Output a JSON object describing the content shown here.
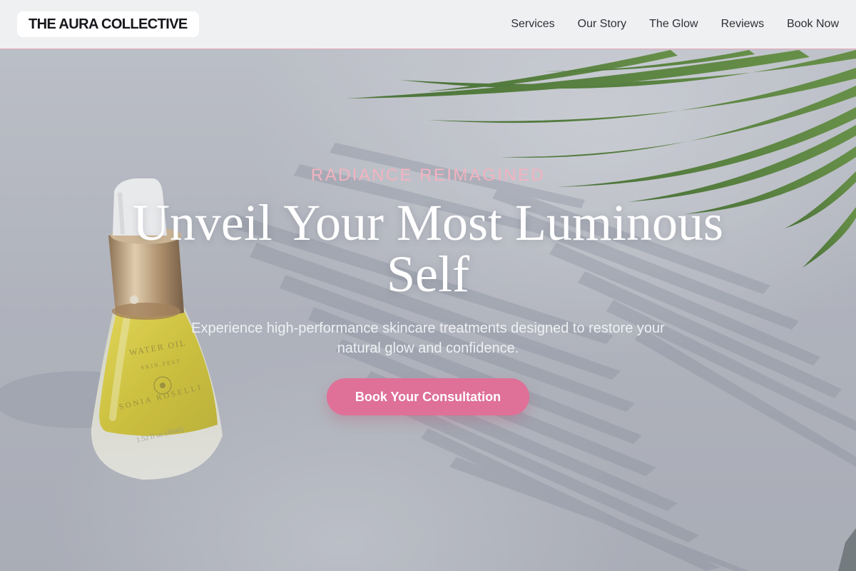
{
  "brand": {
    "name": "THE AURA COLLECTIVE"
  },
  "nav": {
    "items": [
      {
        "label": "Services"
      },
      {
        "label": "Our Story"
      },
      {
        "label": "The Glow"
      },
      {
        "label": "Reviews"
      },
      {
        "label": "Book Now"
      }
    ]
  },
  "hero": {
    "eyebrow": "RADIANCE REIMAGINED",
    "title_line1": "Unveil Your Most Luminous",
    "title_line2": "Self",
    "subtitle_line1": "Experience high-performance skincare treatments designed to restore your",
    "subtitle_line2": "natural glow and confidence.",
    "cta_label": "Book Your Consultation",
    "product_label": {
      "line1": "WATER OIL",
      "line2": "SKIN FEST",
      "brand": "SONIA ROSELLI",
      "size": "1.52 fl oz (45ml)"
    }
  },
  "colors": {
    "accent": "#df7097",
    "eyebrow": "#f3b3c0",
    "nav_border": "#e7a7b7",
    "text_dark": "#16171b"
  }
}
